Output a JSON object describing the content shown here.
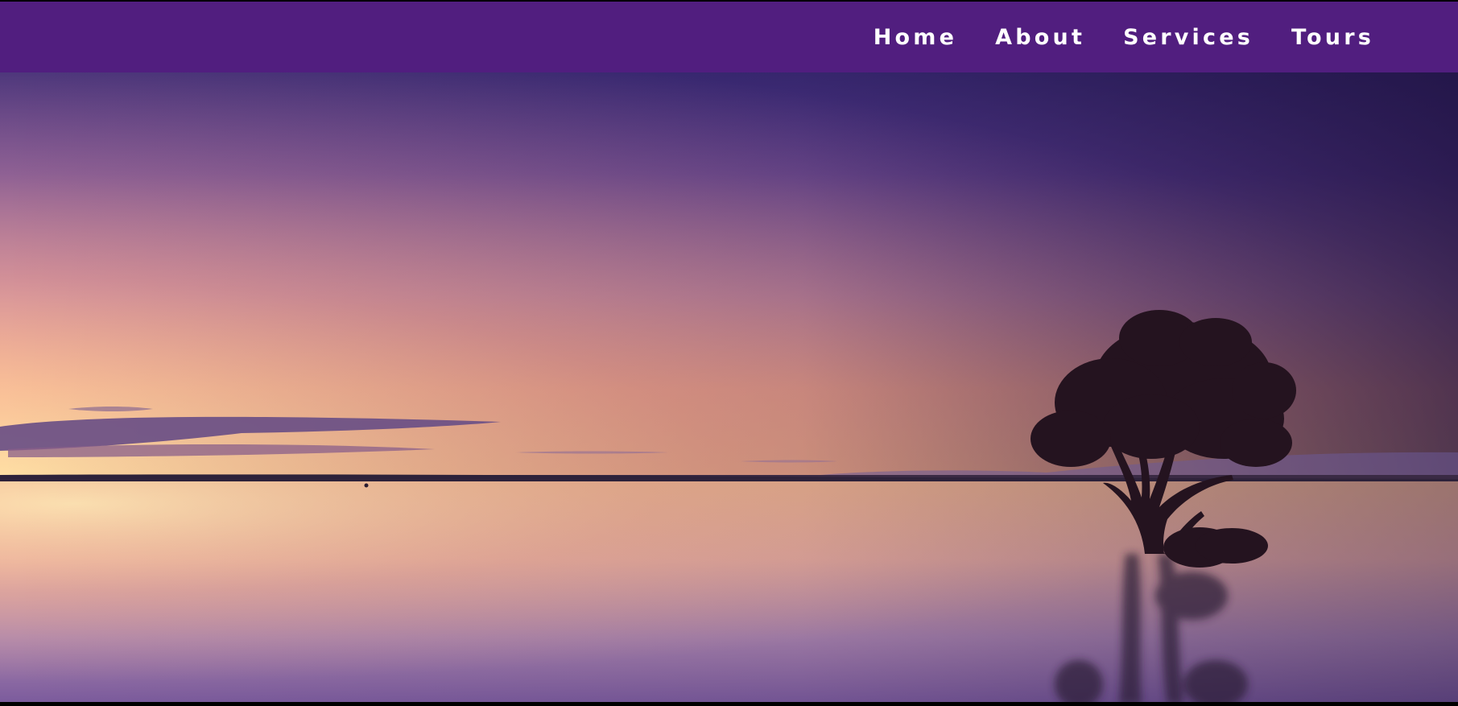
{
  "navbar": {
    "background": "#511e7f",
    "links": [
      {
        "label": "Home"
      },
      {
        "label": "About"
      },
      {
        "label": "Services"
      },
      {
        "label": "Tours"
      }
    ]
  },
  "hero": {
    "image": "sunset-lake-lone-tree-photo"
  }
}
